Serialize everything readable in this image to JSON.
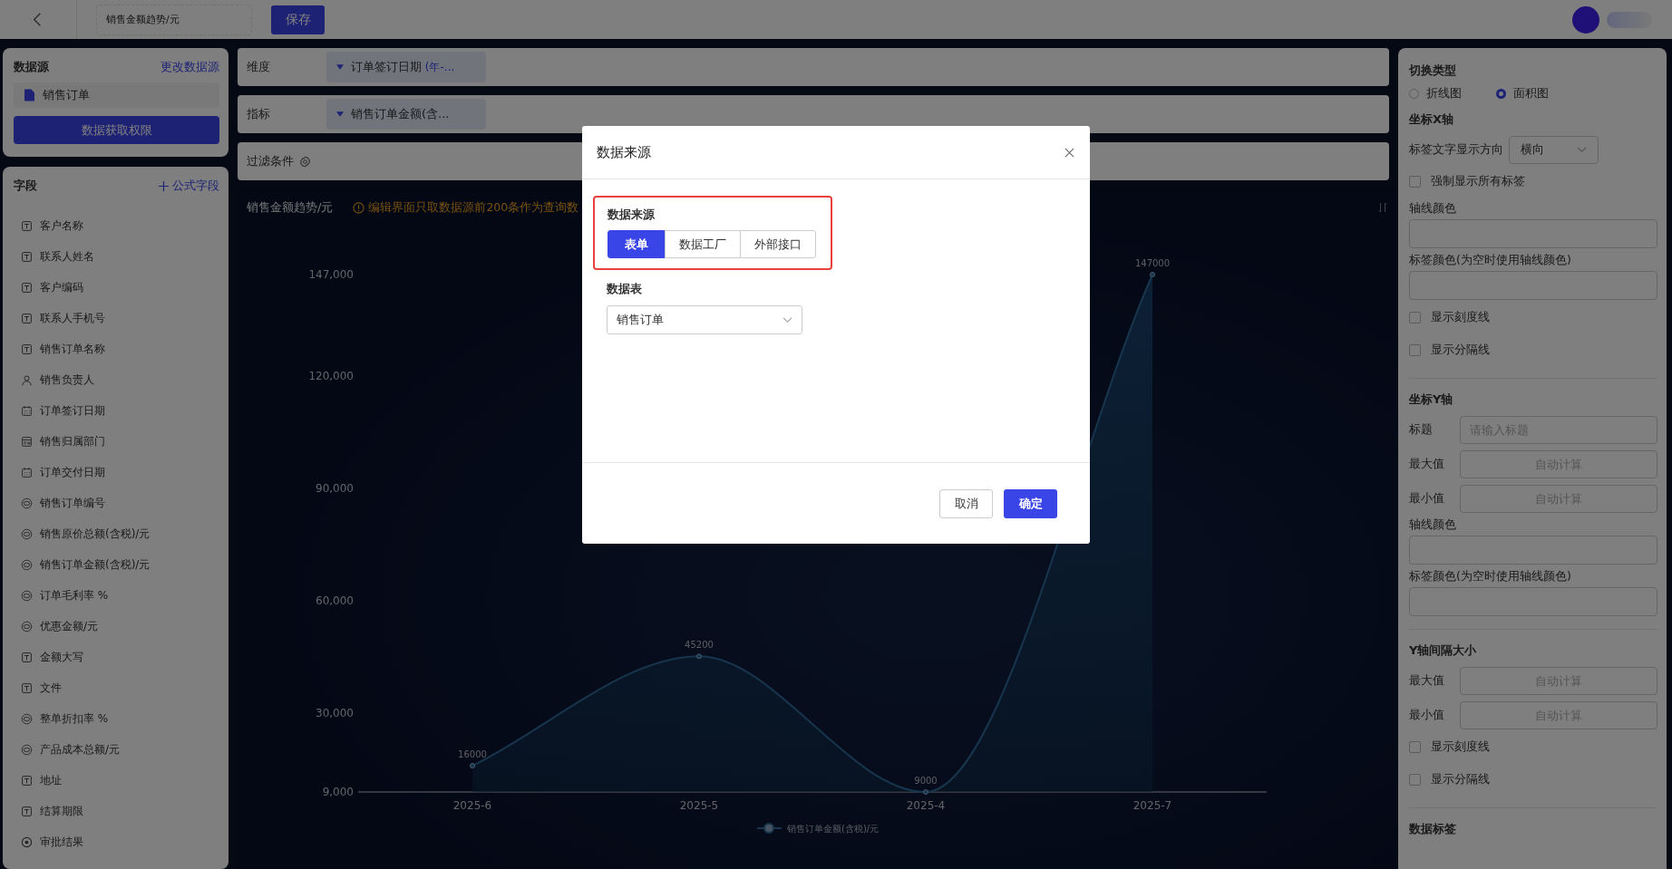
{
  "topbar": {
    "title_field": "销售金额趋势/元",
    "save_button": "保存"
  },
  "datasource": {
    "title": "数据源",
    "change_link": "更改数据源",
    "source": "销售订单",
    "permission_button": "数据获取权限"
  },
  "fields": {
    "title": "字段",
    "add_link": "公式字段",
    "items": [
      {
        "kind": "text",
        "label": "客户名称"
      },
      {
        "kind": "text",
        "label": "联系人姓名"
      },
      {
        "kind": "text",
        "label": "客户编码"
      },
      {
        "kind": "text",
        "label": "联系人手机号"
      },
      {
        "kind": "text",
        "label": "销售订单名称"
      },
      {
        "kind": "person",
        "label": "销售负责人"
      },
      {
        "kind": "date",
        "label": "订单签订日期"
      },
      {
        "kind": "dept",
        "label": "销售归属部门"
      },
      {
        "kind": "date",
        "label": "订单交付日期"
      },
      {
        "kind": "number",
        "label": "销售订单编号"
      },
      {
        "kind": "number",
        "label": "销售原价总额(含税)/元"
      },
      {
        "kind": "number",
        "label": "销售订单金额(含税)/元"
      },
      {
        "kind": "number",
        "label": "订单毛利率 %"
      },
      {
        "kind": "number",
        "label": "优惠金额/元"
      },
      {
        "kind": "text",
        "label": "金额大写"
      },
      {
        "kind": "text",
        "label": "文件"
      },
      {
        "kind": "number",
        "label": "整单折扣率 %"
      },
      {
        "kind": "number",
        "label": "产品成本总额/元"
      },
      {
        "kind": "text",
        "label": "地址"
      },
      {
        "kind": "text",
        "label": "结算期限"
      },
      {
        "kind": "radio",
        "label": "审批结果"
      }
    ]
  },
  "config": {
    "rows": [
      {
        "label": "维度",
        "tag": "订单签订日期",
        "tag_suffix": "(年-..."
      },
      {
        "label": "指标",
        "tag": "销售订单金额(含..."
      }
    ],
    "filter": "过滤条件"
  },
  "chart": {
    "title": "销售金额趋势/元",
    "notice": "编辑界面只取数据源前200条作为查询数",
    "chart_data": {
      "type": "area",
      "categories": [
        "2025-6",
        "2025-5",
        "2025-4",
        "2025-7"
      ],
      "series": [
        {
          "name": "销售订单金额(含税)/元",
          "color": "#2f6a9a",
          "values": [
            16000,
            45200,
            9000,
            147000
          ]
        }
      ],
      "ylim": [
        9000,
        147000
      ],
      "yticks": [
        {
          "value": 9000,
          "label": "9,000"
        },
        {
          "value": 30000,
          "label": "30,000"
        },
        {
          "value": 60000,
          "label": "60,000"
        },
        {
          "value": 90000,
          "label": "90,000"
        },
        {
          "value": 120000,
          "label": "120,000"
        },
        {
          "value": 147000,
          "label": "147,000"
        }
      ],
      "data_labels": true
    }
  },
  "settings": {
    "title": "切换类型",
    "chart_types": [
      {
        "label": "折线图",
        "selected": false
      },
      {
        "label": "面积图",
        "selected": true
      }
    ],
    "sections": [
      {
        "title": "坐标X轴",
        "items": [
          {
            "kind": "select",
            "label": "标签文字显示方向",
            "value": "横向"
          },
          {
            "kind": "checkbox",
            "label": "强制显示所有标签",
            "checked": false
          },
          {
            "kind": "color",
            "label": "轴线颜色"
          },
          {
            "kind": "color",
            "label": "标签颜色(为空时使用轴线颜色)"
          },
          {
            "kind": "checkbox",
            "label": "显示刻度线",
            "checked": false
          },
          {
            "kind": "checkbox",
            "label": "显示分隔线",
            "checked": false
          }
        ]
      },
      {
        "title": "坐标Y轴",
        "items": [
          {
            "kind": "input",
            "label": "标题",
            "placeholder": "请输入标题"
          },
          {
            "kind": "number",
            "label": "最大值",
            "placeholder": "自动计算"
          },
          {
            "kind": "number",
            "label": "最小值",
            "placeholder": "自动计算"
          },
          {
            "kind": "color",
            "label": "轴线颜色"
          },
          {
            "kind": "color",
            "label": "标签颜色(为空时使用轴线颜色)"
          }
        ]
      },
      {
        "title": "Y轴间隔大小",
        "items": [
          {
            "kind": "number",
            "label": "最大值",
            "placeholder": "自动计算"
          },
          {
            "kind": "number",
            "label": "最小值",
            "placeholder": "自动计算"
          },
          {
            "kind": "checkbox",
            "label": "显示刻度线",
            "checked": false
          },
          {
            "kind": "checkbox",
            "label": "显示分隔线",
            "checked": false
          }
        ]
      },
      {
        "title": "数据标签"
      }
    ]
  },
  "modal": {
    "title": "数据来源",
    "source_label": "数据来源",
    "tabs": [
      {
        "label": "表单",
        "selected": true
      },
      {
        "label": "数据工厂",
        "selected": false
      },
      {
        "label": "外部接口",
        "selected": false
      }
    ],
    "table_label": "数据表",
    "table_value": "销售订单",
    "cancel_button": "取消",
    "ok_button": "确定"
  }
}
